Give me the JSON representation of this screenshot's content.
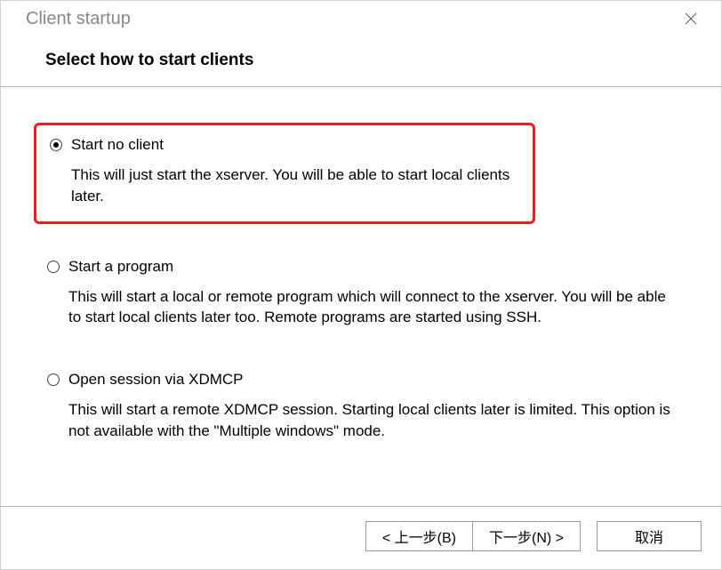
{
  "window": {
    "title": "Client startup"
  },
  "header": {
    "heading": "Select how to start clients"
  },
  "options": {
    "start_no_client": {
      "label": "Start no client",
      "description": "This will just start the xserver. You will be able to start local clients later."
    },
    "start_program": {
      "label": "Start a program",
      "description": "This will start a local or remote program which will connect to the xserver. You will be able to start local clients later too. Remote programs are started using SSH."
    },
    "open_xdmcp": {
      "label": "Open session via XDMCP",
      "description": "This will start a remote XDMCP session. Starting local clients later is limited. This option is not available with the \"Multiple windows\" mode."
    }
  },
  "footer": {
    "back": "< 上一步(B)",
    "next": "下一步(N) >",
    "cancel": "取消"
  }
}
